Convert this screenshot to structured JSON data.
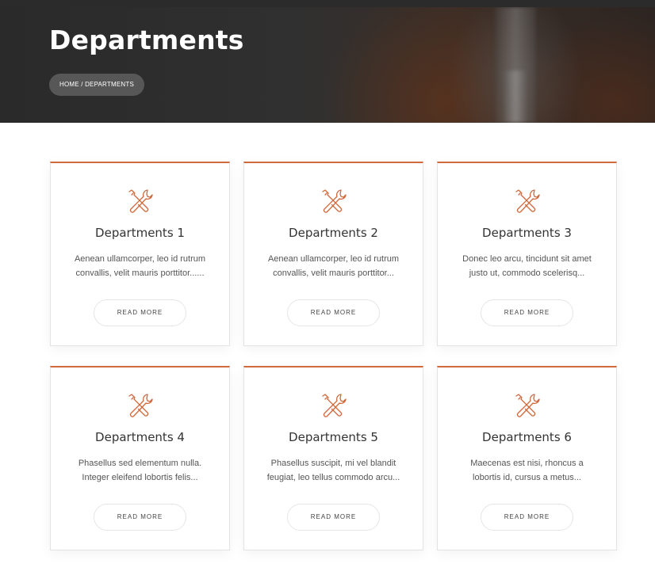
{
  "hero": {
    "title": "Departments",
    "breadcrumb": "HOME / DEPARTMENTS"
  },
  "accent_color": "#d0693c",
  "cards": [
    {
      "title": "Departments 1",
      "desc_line1": "Aenean ullamcorper, leo id rutrum",
      "desc_line2": "convallis, velit mauris porttitor......",
      "button": "READ MORE",
      "icon": "tools-icon"
    },
    {
      "title": "Departments 2",
      "desc_line1": "Aenean ullamcorper, leo id rutrum",
      "desc_line2": "convallis, velit mauris porttitor...",
      "button": "READ MORE",
      "icon": "tools-icon"
    },
    {
      "title": "Departments 3",
      "desc_line1": "Donec leo arcu, tincidunt sit amet",
      "desc_line2": "justo ut, commodo scelerisq...",
      "button": "READ MORE",
      "icon": "tools-icon"
    },
    {
      "title": "Departments 4",
      "desc_line1": "Phasellus sed elementum nulla.",
      "desc_line2": "Integer eleifend lobortis felis...",
      "button": "READ MORE",
      "icon": "tools-icon"
    },
    {
      "title": "Departments 5",
      "desc_line1": "Phasellus suscipit, mi vel blandit",
      "desc_line2": "feugiat, leo tellus commodo arcu...",
      "button": "READ MORE",
      "icon": "tools-icon"
    },
    {
      "title": "Departments 6",
      "desc_line1": "Maecenas est nisi, rhoncus a",
      "desc_line2": "lobortis id, cursus a metus...",
      "button": "READ MORE",
      "icon": "tools-icon"
    }
  ]
}
